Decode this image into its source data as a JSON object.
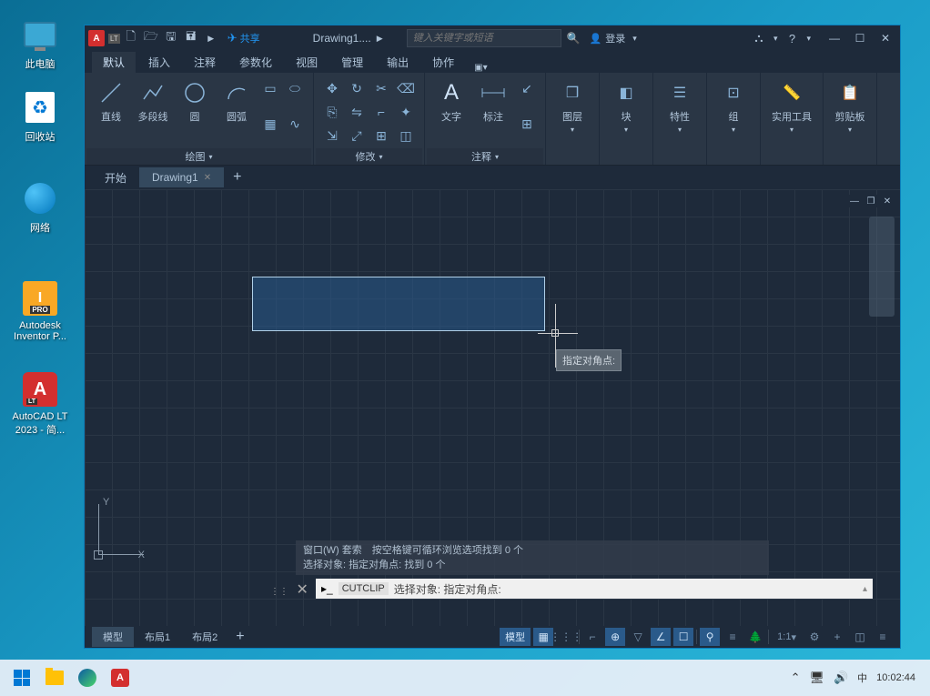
{
  "desktop": {
    "icons": {
      "this_pc": "此电脑",
      "recycle_bin": "回收站",
      "network": "网络",
      "inventor": "Autodesk\nInventor P...",
      "autocad": "AutoCAD LT\n2023 - 简..."
    }
  },
  "titlebar": {
    "share": "共享",
    "title": "Drawing1....",
    "search_placeholder": "键入关键字或短语",
    "login": "登录"
  },
  "ribbon": {
    "tabs": [
      "默认",
      "插入",
      "注释",
      "参数化",
      "视图",
      "管理",
      "输出",
      "协作"
    ],
    "active_tab": 0,
    "panels": {
      "draw": {
        "label": "绘图",
        "line": "直线",
        "polyline": "多段线",
        "circle": "圆",
        "arc": "圆弧"
      },
      "modify": {
        "label": "修改"
      },
      "annot": {
        "label": "注释",
        "text": "文字",
        "dim": "标注"
      },
      "layers": {
        "label": "图层"
      },
      "block": {
        "label": "块"
      },
      "props": {
        "label": "特性"
      },
      "group": {
        "label": "组"
      },
      "util": {
        "label": "实用工具"
      },
      "clip": {
        "label": "剪贴板"
      }
    }
  },
  "doc_tabs": {
    "start": "开始",
    "drawing": "Drawing1"
  },
  "canvas": {
    "tooltip": "指定对角点:",
    "history_line1": "窗口(W) 套索　按空格键可循环浏览选项找到 0 个",
    "history_line2": "选择对象: 指定对角点: 找到 0 个",
    "cmd_label": "CUTCLIP",
    "cmd_text": "选择对象: 指定对角点:"
  },
  "layout_tabs": {
    "model": "模型",
    "layout1": "布局1",
    "layout2": "布局2"
  },
  "status": {
    "model": "模型",
    "scale": "1:1"
  },
  "taskbar": {
    "ime": "中",
    "time": "10:02:44"
  }
}
